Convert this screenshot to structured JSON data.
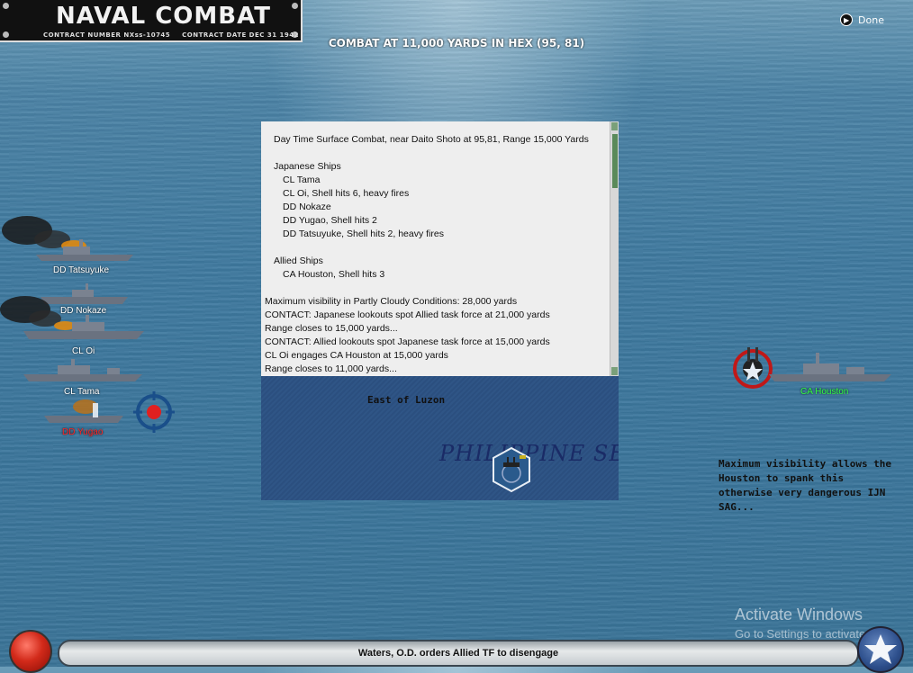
{
  "title_plate": {
    "title": "NAVAL COMBAT",
    "contract_number": "CONTRACT NUMBER  NXss-10745",
    "contract_date": "CONTRACT DATE  DEC 31 1942"
  },
  "header": {
    "combat_location": "COMBAT AT 11,000 YARDS IN HEX (95, 81)",
    "done_label": "Done"
  },
  "report": {
    "lines": [
      {
        "text": "Day Time Surface Combat, near Daito Shoto at 95,81, Range 15,000 Yards",
        "indent": 1
      },
      {
        "text": "",
        "indent": 0
      },
      {
        "text": "Japanese Ships",
        "indent": 1
      },
      {
        "text": "CL Tama",
        "indent": 2
      },
      {
        "text": "CL Oi, Shell hits 6,  heavy fires",
        "indent": 2
      },
      {
        "text": "DD Nokaze",
        "indent": 2
      },
      {
        "text": "DD Yugao, Shell hits 2",
        "indent": 2
      },
      {
        "text": "DD Tatsuyuke, Shell hits 2,  heavy fires",
        "indent": 2
      },
      {
        "text": "",
        "indent": 0
      },
      {
        "text": "Allied Ships",
        "indent": 1
      },
      {
        "text": "CA Houston, Shell hits 3",
        "indent": 2
      },
      {
        "text": "",
        "indent": 0
      },
      {
        "text": "Maximum visibility in Partly Cloudy Conditions: 28,000 yards",
        "indent": 0
      },
      {
        "text": "CONTACT: Japanese lookouts spot Allied task force at 21,000 yards",
        "indent": 0
      },
      {
        "text": "Range closes to 15,000 yards...",
        "indent": 0
      },
      {
        "text": "CONTACT: Allied lookouts spot Japanese task force at 15,000 yards",
        "indent": 0
      },
      {
        "text": "CL Oi engages CA Houston at 15,000 yards",
        "indent": 0
      },
      {
        "text": "Range closes to 11,000 yards...",
        "indent": 0
      }
    ]
  },
  "minimap": {
    "region": "East of Luzon",
    "sea_name": "PHILIPPINE SEA"
  },
  "japanese_ships": [
    {
      "label": "DD Tatsuyuke",
      "status": "burning"
    },
    {
      "label": "DD Nokaze",
      "status": "normal"
    },
    {
      "label": "CL Oi",
      "status": "burning"
    },
    {
      "label": "CL Tama",
      "status": "normal"
    },
    {
      "label": "DD Yugao",
      "status": "hit"
    }
  ],
  "allied_ships": [
    {
      "label": "CA Houston",
      "status": "firing"
    }
  ],
  "commentary": "Maximum visibility allows the Houston to spank this otherwise very dangerous IJN SAG...",
  "watermark": {
    "line1": "Activate Windows",
    "line2": "Go to Settings to activate Win"
  },
  "status_bar": {
    "message": "Waters, O.D. orders Allied TF to disengage"
  },
  "colors": {
    "japanese_target_label": "#ff2222",
    "allied_label": "#33ff44",
    "report_bg": "#eeeeee",
    "minimap_bg": "#2f5586"
  }
}
